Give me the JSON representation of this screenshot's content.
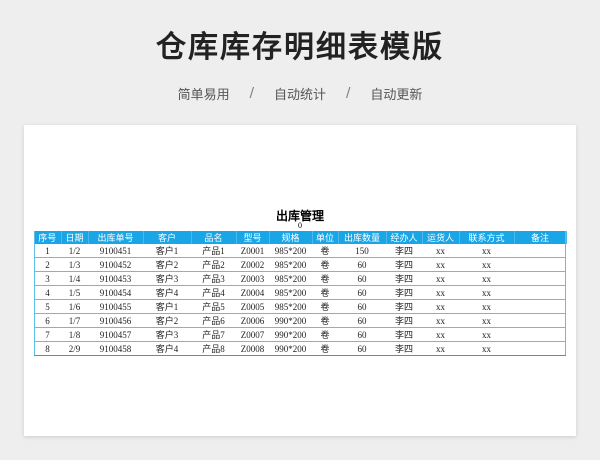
{
  "page": {
    "title": "仓库库存明细表模版",
    "tags": [
      "简单易用",
      "自动统计",
      "自动更新"
    ],
    "separator": "/"
  },
  "sheet": {
    "title": "出库管理",
    "subtitle": "0",
    "columns": [
      "序号",
      "日期",
      "出库单号",
      "客户",
      "品名",
      "型号",
      "规格",
      "单位",
      "出库数量",
      "经办人",
      "运货人",
      "联系方式",
      "备注"
    ],
    "rows": [
      [
        "1",
        "1/2",
        "9100451",
        "客户1",
        "产品1",
        "Z0001",
        "985*200",
        "卷",
        "150",
        "李四",
        "xx",
        "xx",
        ""
      ],
      [
        "2",
        "1/3",
        "9100452",
        "客户2",
        "产品2",
        "Z0002",
        "985*200",
        "卷",
        "60",
        "李四",
        "xx",
        "xx",
        ""
      ],
      [
        "3",
        "1/4",
        "9100453",
        "客户3",
        "产品3",
        "Z0003",
        "985*200",
        "卷",
        "60",
        "李四",
        "xx",
        "xx",
        ""
      ],
      [
        "4",
        "1/5",
        "9100454",
        "客户4",
        "产品4",
        "Z0004",
        "985*200",
        "卷",
        "60",
        "李四",
        "xx",
        "xx",
        ""
      ],
      [
        "5",
        "1/6",
        "9100455",
        "客户1",
        "产品5",
        "Z0005",
        "985*200",
        "卷",
        "60",
        "李四",
        "xx",
        "xx",
        ""
      ],
      [
        "6",
        "1/7",
        "9100456",
        "客户2",
        "产品6",
        "Z0006",
        "990*200",
        "卷",
        "60",
        "李四",
        "xx",
        "xx",
        ""
      ],
      [
        "7",
        "1/8",
        "9100457",
        "客户3",
        "产品7",
        "Z0007",
        "990*200",
        "卷",
        "60",
        "李四",
        "xx",
        "xx",
        ""
      ],
      [
        "8",
        "2/9",
        "9100458",
        "客户4",
        "产品8",
        "Z0008",
        "990*200",
        "卷",
        "60",
        "李四",
        "xx",
        "xx",
        ""
      ]
    ]
  },
  "colors": {
    "header_bg": "#1aa6e6",
    "row_line": "#5fbfe8"
  }
}
